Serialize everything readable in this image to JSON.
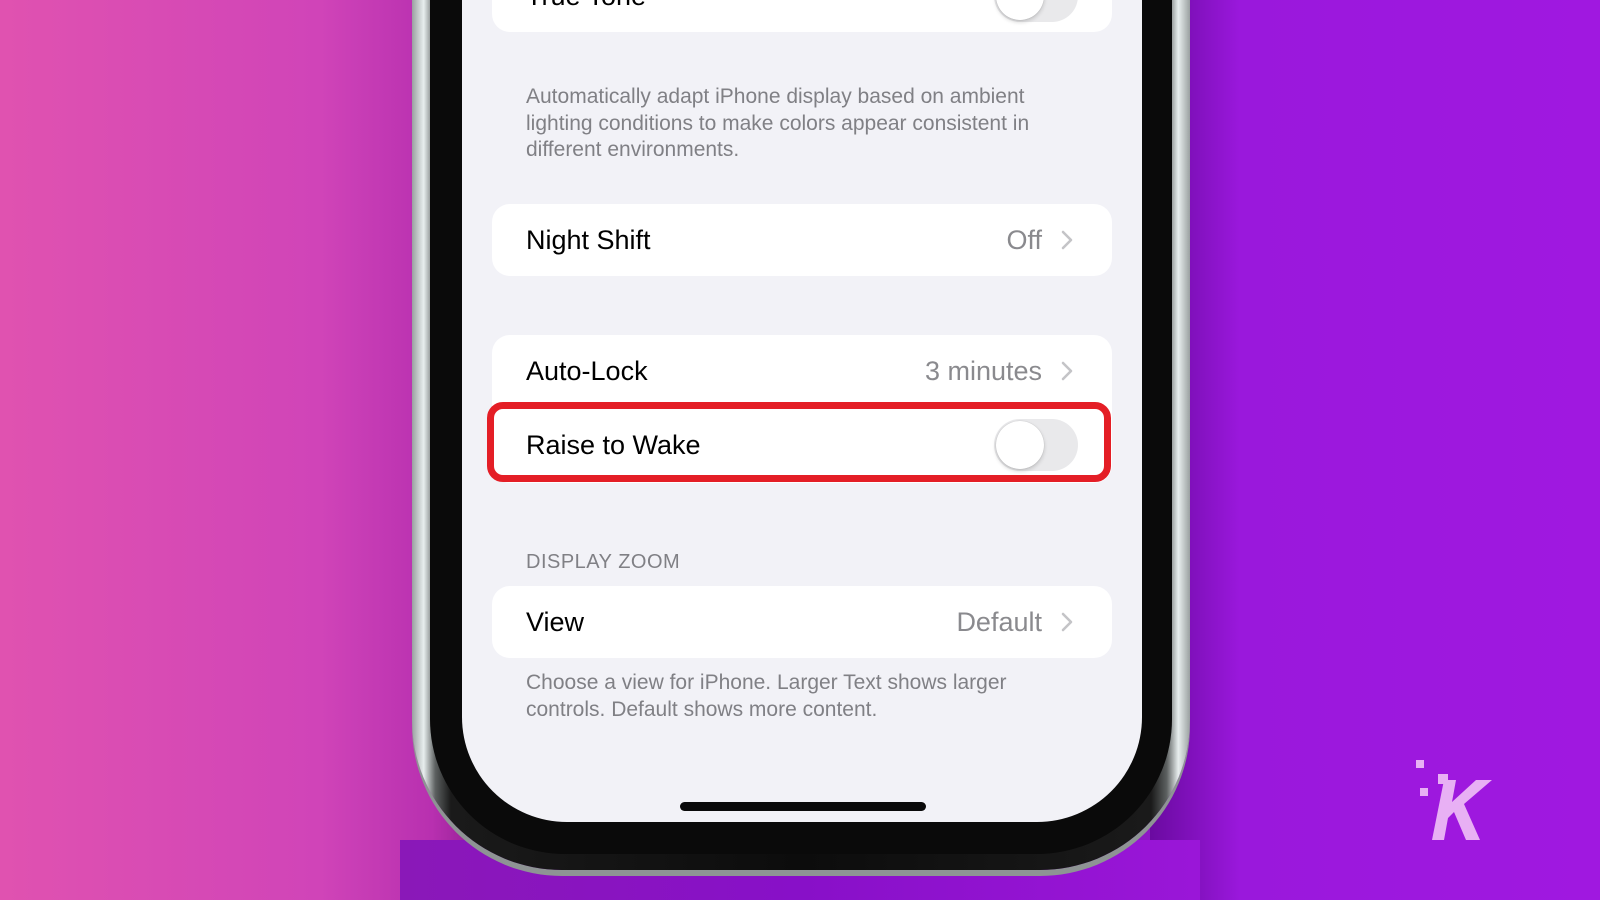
{
  "settings": {
    "true_tone": {
      "label": "True Tone",
      "enabled": false,
      "footnote": "Automatically adapt iPhone display based on ambient lighting conditions to make colors appear consistent in different environments."
    },
    "night_shift": {
      "label": "Night Shift",
      "value": "Off"
    },
    "auto_lock": {
      "label": "Auto-Lock",
      "value": "3 minutes"
    },
    "raise_to_wake": {
      "label": "Raise to Wake",
      "enabled": false
    },
    "display_zoom": {
      "section_header": "DISPLAY ZOOM",
      "view": {
        "label": "View",
        "value": "Default"
      },
      "footnote": "Choose a view for iPhone. Larger Text shows larger controls. Default shows more content."
    }
  },
  "annotation": {
    "highlight_color": "#e41e26",
    "highlighted_item": "Raise to Wake"
  },
  "branding": {
    "logo": "K"
  }
}
